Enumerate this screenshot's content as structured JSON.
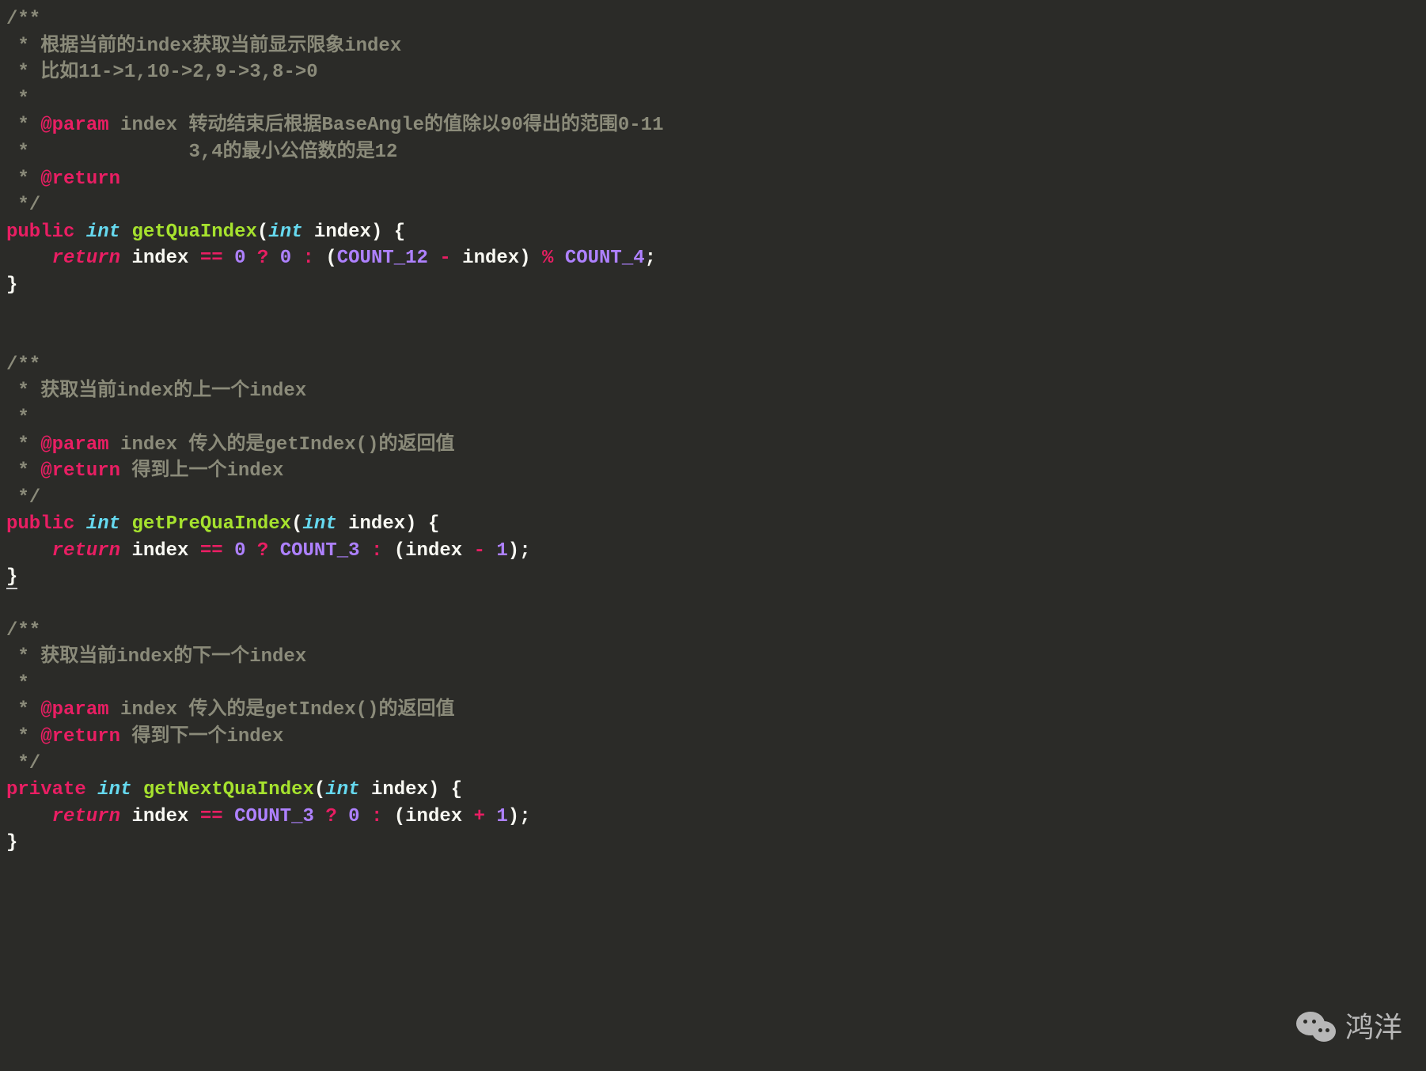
{
  "code": {
    "block1": {
      "c1": "/**",
      "c2": " * 根据当前的index获取当前显示限象index",
      "c3": " * 比如11->1,10->2,9->3,8->0",
      "c4": " *",
      "c5_prefix": " * ",
      "c5_tag": "@param",
      "c5_rest": " index 转动结束后根据BaseAngle的值除以90得出的范围0-11",
      "c6": " *              3,4的最小公倍数的是12",
      "c7_prefix": " * ",
      "c7_tag": "@return",
      "c8": " */",
      "modifier": "public",
      "type": "int",
      "method": "getQuaIndex",
      "param_type": "int",
      "param_name": "index",
      "ret_kw": "return",
      "ret_expr_var": "index",
      "ret_eq": "==",
      "ret_zero1": "0",
      "ret_q": "?",
      "ret_zero2": "0",
      "ret_colon": ":",
      "ret_lparen": "(",
      "ret_const1": "COUNT_12",
      "ret_minus": "-",
      "ret_var2": "index",
      "ret_rparen": ")",
      "ret_mod": "%",
      "ret_const2": "COUNT_4"
    },
    "block2": {
      "c1": "/**",
      "c2": " * 获取当前index的上一个index",
      "c3": " *",
      "c4_prefix": " * ",
      "c4_tag": "@param",
      "c4_rest": " index 传入的是getIndex()的返回值",
      "c5_prefix": " * ",
      "c5_tag": "@return",
      "c5_rest": " 得到上一个index",
      "c6": " */",
      "modifier": "public",
      "type": "int",
      "method": "getPreQuaIndex",
      "param_type": "int",
      "param_name": "index",
      "ret_kw": "return",
      "ret_var": "index",
      "ret_eq": "==",
      "ret_zero": "0",
      "ret_q": "?",
      "ret_const": "COUNT_3",
      "ret_colon": ":",
      "ret_lparen": "(",
      "ret_var2": "index",
      "ret_minus": "-",
      "ret_one": "1",
      "ret_rparen": ")"
    },
    "block3": {
      "c1": "/**",
      "c2": " * 获取当前index的下一个index",
      "c3": " *",
      "c4_prefix": " * ",
      "c4_tag": "@param",
      "c4_rest": " index 传入的是getIndex()的返回值",
      "c5_prefix": " * ",
      "c5_tag": "@return",
      "c5_rest": " 得到下一个index",
      "c6": " */",
      "modifier": "private",
      "type": "int",
      "method": "getNextQuaIndex",
      "param_type": "int",
      "param_name": "index",
      "ret_kw": "return",
      "ret_var": "index",
      "ret_eq": "==",
      "ret_const": "COUNT_3",
      "ret_q": "?",
      "ret_zero": "0",
      "ret_colon": ":",
      "ret_lparen": "(",
      "ret_var2": "index",
      "ret_plus": "+",
      "ret_one": "1",
      "ret_rparen": ")"
    }
  },
  "watermark": "鸿洋"
}
